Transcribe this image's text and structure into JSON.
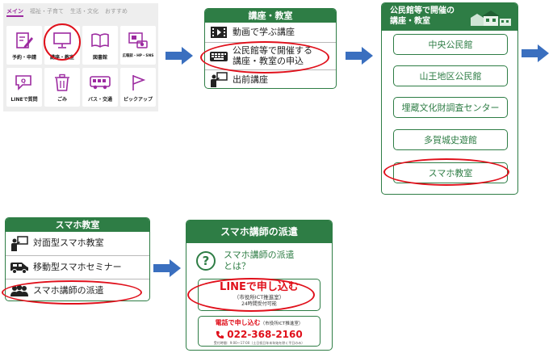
{
  "app_grid": {
    "tabs": [
      "メイン",
      "福祉・子育て",
      "生活・文化",
      "おすすめ"
    ],
    "tiles": [
      {
        "label": "予約・申請",
        "icon": "form-pencil-icon"
      },
      {
        "label": "講座・教室",
        "icon": "monitor-icon"
      },
      {
        "label": "図書館",
        "icon": "book-icon"
      },
      {
        "label": "広報誌・HP・SNS",
        "icon": "media-icon"
      },
      {
        "label": "LINEで質問",
        "icon": "chat-icon"
      },
      {
        "label": "ごみ",
        "icon": "trash-icon"
      },
      {
        "label": "バス・交通",
        "icon": "bus-icon"
      },
      {
        "label": "ピックアップ",
        "icon": "flag-icon"
      }
    ]
  },
  "courses_menu": {
    "title": "講座・教室",
    "items": [
      {
        "label": "動画で学ぶ講座",
        "icon": "film-icon"
      },
      {
        "label_line1": "公民館等で開催する",
        "label_line2": "講座・教室の申込",
        "icon": "keyboard-icon"
      },
      {
        "label": "出前講座",
        "icon": "lecture-icon"
      }
    ]
  },
  "facilities": {
    "title_line1": "公民館等で開催の",
    "title_line2": "講座・教室",
    "items": [
      "中央公民館",
      "山王地区公民館",
      "埋蔵文化財調査センター",
      "多賀城史遊館",
      "スマホ教室"
    ]
  },
  "smartphone_class": {
    "title": "スマホ教室",
    "items": [
      {
        "label": "対面型スマホ教室",
        "icon": "teacher-board-icon"
      },
      {
        "label": "移動型スマホセミナー",
        "icon": "van-icon"
      },
      {
        "label": "スマホ講師の派遣",
        "icon": "people-icon"
      }
    ]
  },
  "dispatch": {
    "title": "スマホ講師の派遣",
    "question_line1": "スマホ講師の派遣",
    "question_line2": "とは？",
    "line_apply": "LINEで申し込む",
    "line_dept": "（市役所ICT推進室）",
    "line_hours": "24時間受付可能",
    "phone_apply": "電話で申し込む",
    "phone_dept": "（市役所ICT推進室）",
    "phone_number": "022-368-2160",
    "phone_hours": "受付時間：9:00～17:00（土日祝日年末年始を除く平日のみ）"
  },
  "colors": {
    "green": "#2e7d45",
    "purple": "#9c2aa0",
    "highlight": "#e0101b",
    "arrow": "#3a6fbf"
  }
}
